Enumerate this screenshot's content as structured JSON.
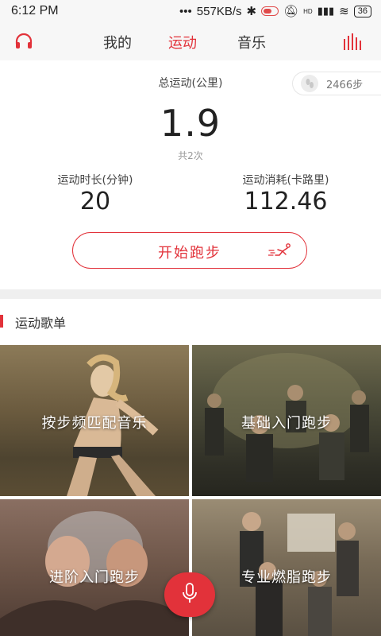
{
  "status_bar": {
    "time": "6:12 PM",
    "network_speed": "557KB/s",
    "signal_label": "HD",
    "battery": "36"
  },
  "top_nav": {
    "tabs": [
      {
        "label": "我的",
        "active": false
      },
      {
        "label": "运动",
        "active": true
      },
      {
        "label": "音乐",
        "active": false
      }
    ],
    "left_icon": "headphones-icon",
    "right_icon": "bars-icon"
  },
  "summary": {
    "steps": "2466步",
    "total_label": "总运动(公里)",
    "total_value": "1.9",
    "count_label": "共2次",
    "duration_label": "运动时长(分钟)",
    "duration_value": "20",
    "calories_label": "运动消耗(卡路里)",
    "calories_value": "112.46",
    "start_button": "开始跑步"
  },
  "playlist_section": {
    "title": "运动歌单",
    "items": [
      {
        "label": "按步频匹配音乐"
      },
      {
        "label": "基础入门跑步"
      },
      {
        "label": "进阶入门跑步"
      },
      {
        "label": "专业燃脂跑步"
      }
    ]
  },
  "colors": {
    "accent": "#e2323a"
  }
}
